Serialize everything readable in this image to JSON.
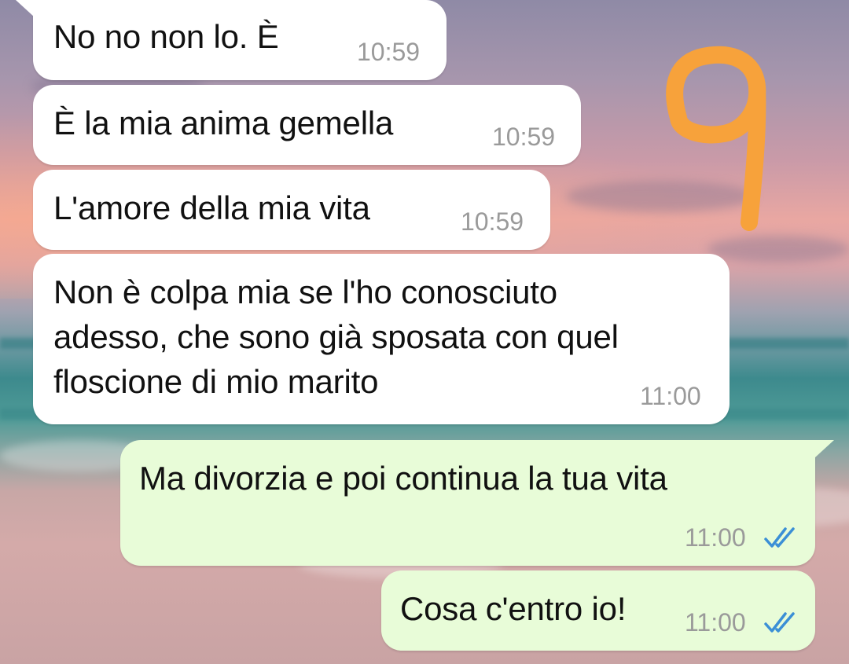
{
  "chat": {
    "messages": [
      {
        "direction": "incoming",
        "text": "No no non lo. È",
        "time": "10:59"
      },
      {
        "direction": "incoming",
        "text": "È la mia anima gemella",
        "time": "10:59"
      },
      {
        "direction": "incoming",
        "text": "L'amore della mia vita",
        "time": "10:59"
      },
      {
        "direction": "incoming",
        "text": "Non è colpa mia se l'ho conosciuto\nadesso, che sono già sposata con quel\nfloscione di mio marito",
        "time": "11:00"
      },
      {
        "direction": "outgoing",
        "text": "Ma divorzia e poi continua la tua vita",
        "time": "11:00",
        "status": "read"
      },
      {
        "direction": "outgoing",
        "text": "Cosa c'entro io!",
        "time": "11:00",
        "status": "read"
      }
    ]
  },
  "annotation": {
    "icon": "orange-hand-drawn-number-9",
    "color": "#f7a23b"
  },
  "colors": {
    "incoming_bubble": "#ffffff",
    "outgoing_bubble": "#e8fcd8",
    "read_ticks": "#3b8fd6",
    "timestamp": "#9a9a9a"
  }
}
